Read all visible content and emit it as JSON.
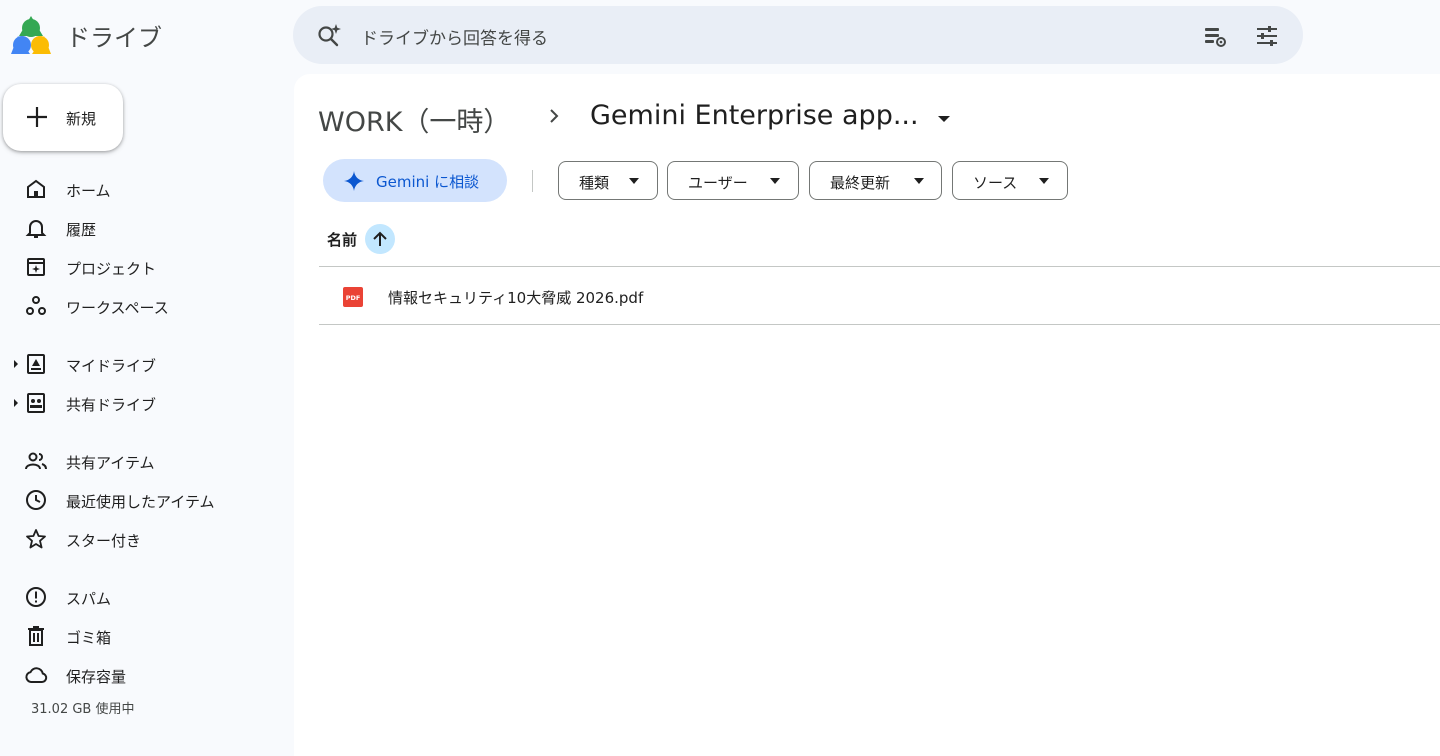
{
  "app": {
    "title": "ドライブ"
  },
  "search": {
    "placeholder": "ドライブから回答を得る"
  },
  "new_button": {
    "label": "新規"
  },
  "sidebar": {
    "items": [
      {
        "label": "ホーム",
        "icon": "home-icon"
      },
      {
        "label": "履歴",
        "icon": "bell-icon"
      },
      {
        "label": "プロジェクト",
        "icon": "project-icon"
      },
      {
        "label": "ワークスペース",
        "icon": "workspace-icon"
      },
      {
        "label": "マイドライブ",
        "icon": "my-drive-icon"
      },
      {
        "label": "共有ドライブ",
        "icon": "shared-drive-icon"
      },
      {
        "label": "共有アイテム",
        "icon": "people-icon"
      },
      {
        "label": "最近使用したアイテム",
        "icon": "clock-icon"
      },
      {
        "label": "スター付き",
        "icon": "star-icon"
      },
      {
        "label": "スパム",
        "icon": "spam-icon"
      },
      {
        "label": "ゴミ箱",
        "icon": "trash-icon"
      },
      {
        "label": "保存容量",
        "icon": "cloud-icon"
      }
    ],
    "storage_text": "31.02 GB 使用中"
  },
  "breadcrumb": {
    "parent": "WORK（一時）",
    "current": "Gemini Enterprise app..."
  },
  "toolbar": {
    "gemini_label": "Gemini に相談",
    "filters": [
      "種類",
      "ユーザー",
      "最終更新",
      "ソース"
    ]
  },
  "table": {
    "column_name": "名前",
    "rows": [
      {
        "name": "情報セキュリティ10大脅威 2026.pdf",
        "type_icon": "pdf-icon"
      }
    ]
  },
  "colors": {
    "accent": "#0b57d0",
    "gemini_bg": "#d3e3fd",
    "sort_bg": "#c2e7ff",
    "pdf_red": "#ea4335",
    "sidebar_bg": "#f8fafd",
    "search_bg": "#e9eef6"
  }
}
